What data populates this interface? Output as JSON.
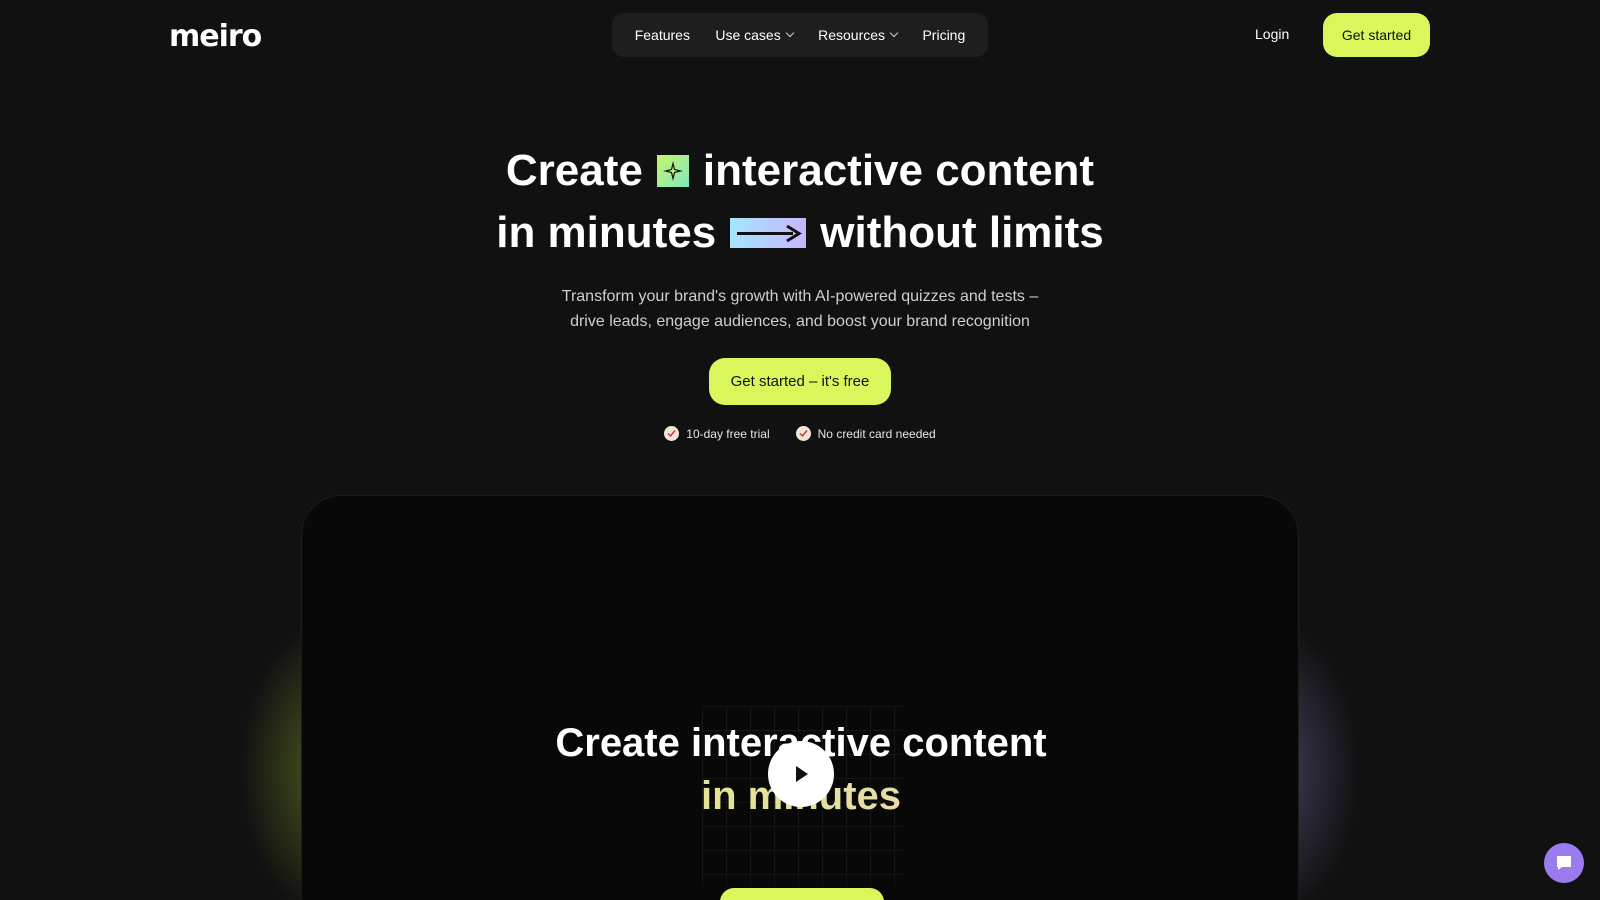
{
  "brand": {
    "logo_text": "meiro"
  },
  "nav": {
    "items": [
      {
        "label": "Features"
      },
      {
        "label": "Use cases"
      },
      {
        "label": "Resources"
      },
      {
        "label": "Pricing"
      }
    ],
    "login_label": "Login",
    "cta_label": "Get started"
  },
  "hero": {
    "line1_start": "Create",
    "line1_end": "interactive content",
    "line2_start": "in minutes",
    "line2_end": "without limits",
    "subtitle_line1": "Transform your brand's growth with AI-powered quizzes and tests –",
    "subtitle_line2": "drive leads, engage audiences, and boost your brand recognition",
    "cta_label": "Get started – it's free",
    "perks": [
      {
        "label": "10-day free trial"
      },
      {
        "label": "No credit card needed"
      }
    ]
  },
  "video": {
    "title_line1": "Create interactive content",
    "title_line2": "in minutes"
  },
  "colors": {
    "accent": "#d9f75b",
    "background": "#111111",
    "chat": "#9b7cf0"
  }
}
